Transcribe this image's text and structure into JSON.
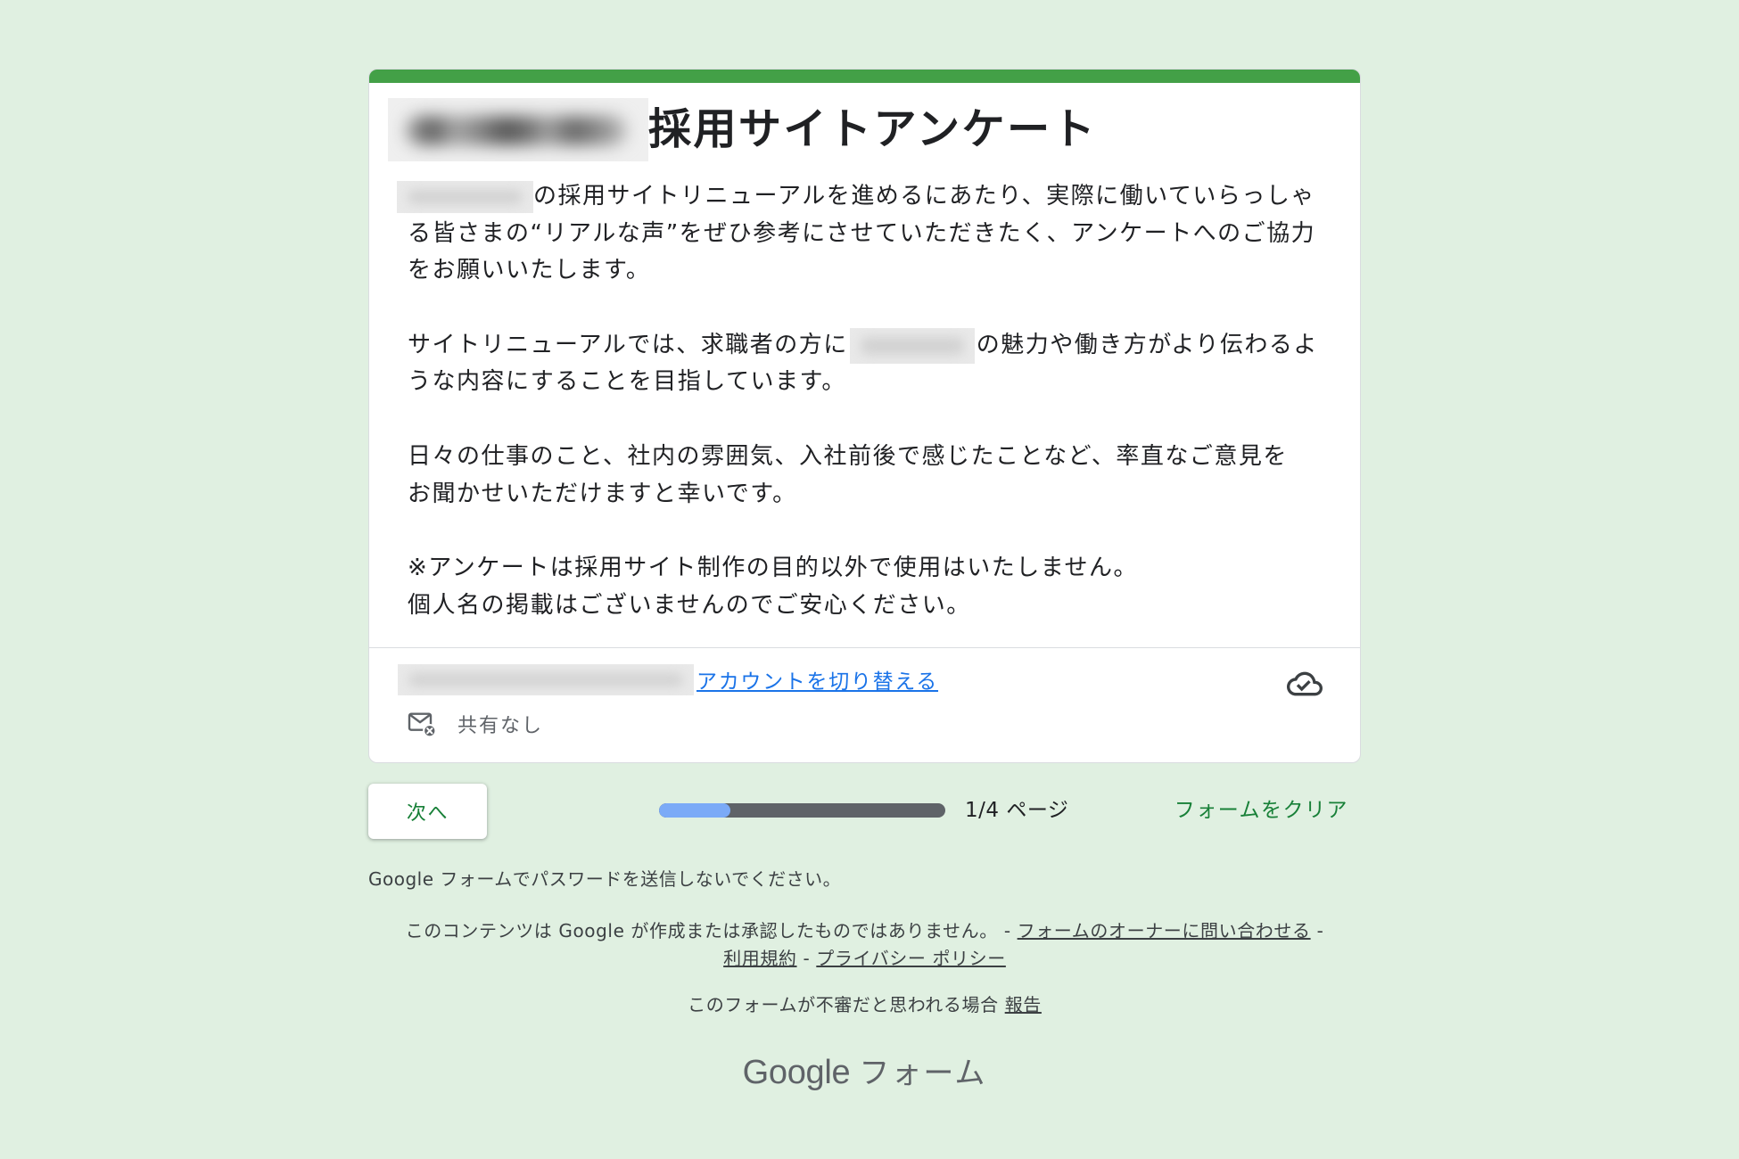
{
  "theme": {
    "accent_bar": "#43a047",
    "page_background": "#e0f0e1",
    "link": "#1a73e8",
    "action_text": "#188038",
    "progress_fill": "#7baaf7",
    "progress_track": "#5f6368"
  },
  "form": {
    "title": "採用サイトアンケート",
    "description": {
      "p1": [
        "の採用サイトリニューアルを進めるにあたり、実際に働いていらっしゃ",
        "る皆さまの“リアルな声”をぜひ参考にさせていただきたく、アンケートへのご協力",
        "をお願いいたします。"
      ],
      "p2": {
        "line1_before": "サイトリニューアルでは、求職者の方に",
        "line1_after": "の魅力や働き方がより伝わるよ",
        "line2": "うな内容にすることを目指しています。"
      },
      "p3": [
        "日々の仕事のこと、社内の雰囲気、入社前後で感じたことなど、率直なご意見を",
        "お聞かせいただけますと幸いです。"
      ],
      "p4": [
        "※アンケートは採用サイト制作の目的以外で使用はいたしません。",
        "個人名の掲載はございませんのでご安心ください。"
      ]
    }
  },
  "account": {
    "switch_account_label": "アカウントを切り替える",
    "sharing_label": "共有なし"
  },
  "icons": {
    "save_status": "cloud-done-icon",
    "sharing": "mail-off-icon"
  },
  "navigation": {
    "next_label": "次へ",
    "progress_fraction": 0.25,
    "page_indicator": "1/4 ページ",
    "clear_form_label": "フォームをクリア"
  },
  "footer": {
    "password_warning": "Google フォームでパスワードを送信しないでください。",
    "disclaimer": "このコンテンツは Google が作成または承認したものではありません。",
    "separator": "-",
    "contact_owner_link": "フォームのオーナーに問い合わせる",
    "terms_link": "利用規約",
    "privacy_link": "プライバシー ポリシー",
    "abuse_prompt": "このフォームが不審だと思われる場合",
    "report_link": "報告",
    "logo_google": "Google",
    "logo_product": "フォーム"
  }
}
